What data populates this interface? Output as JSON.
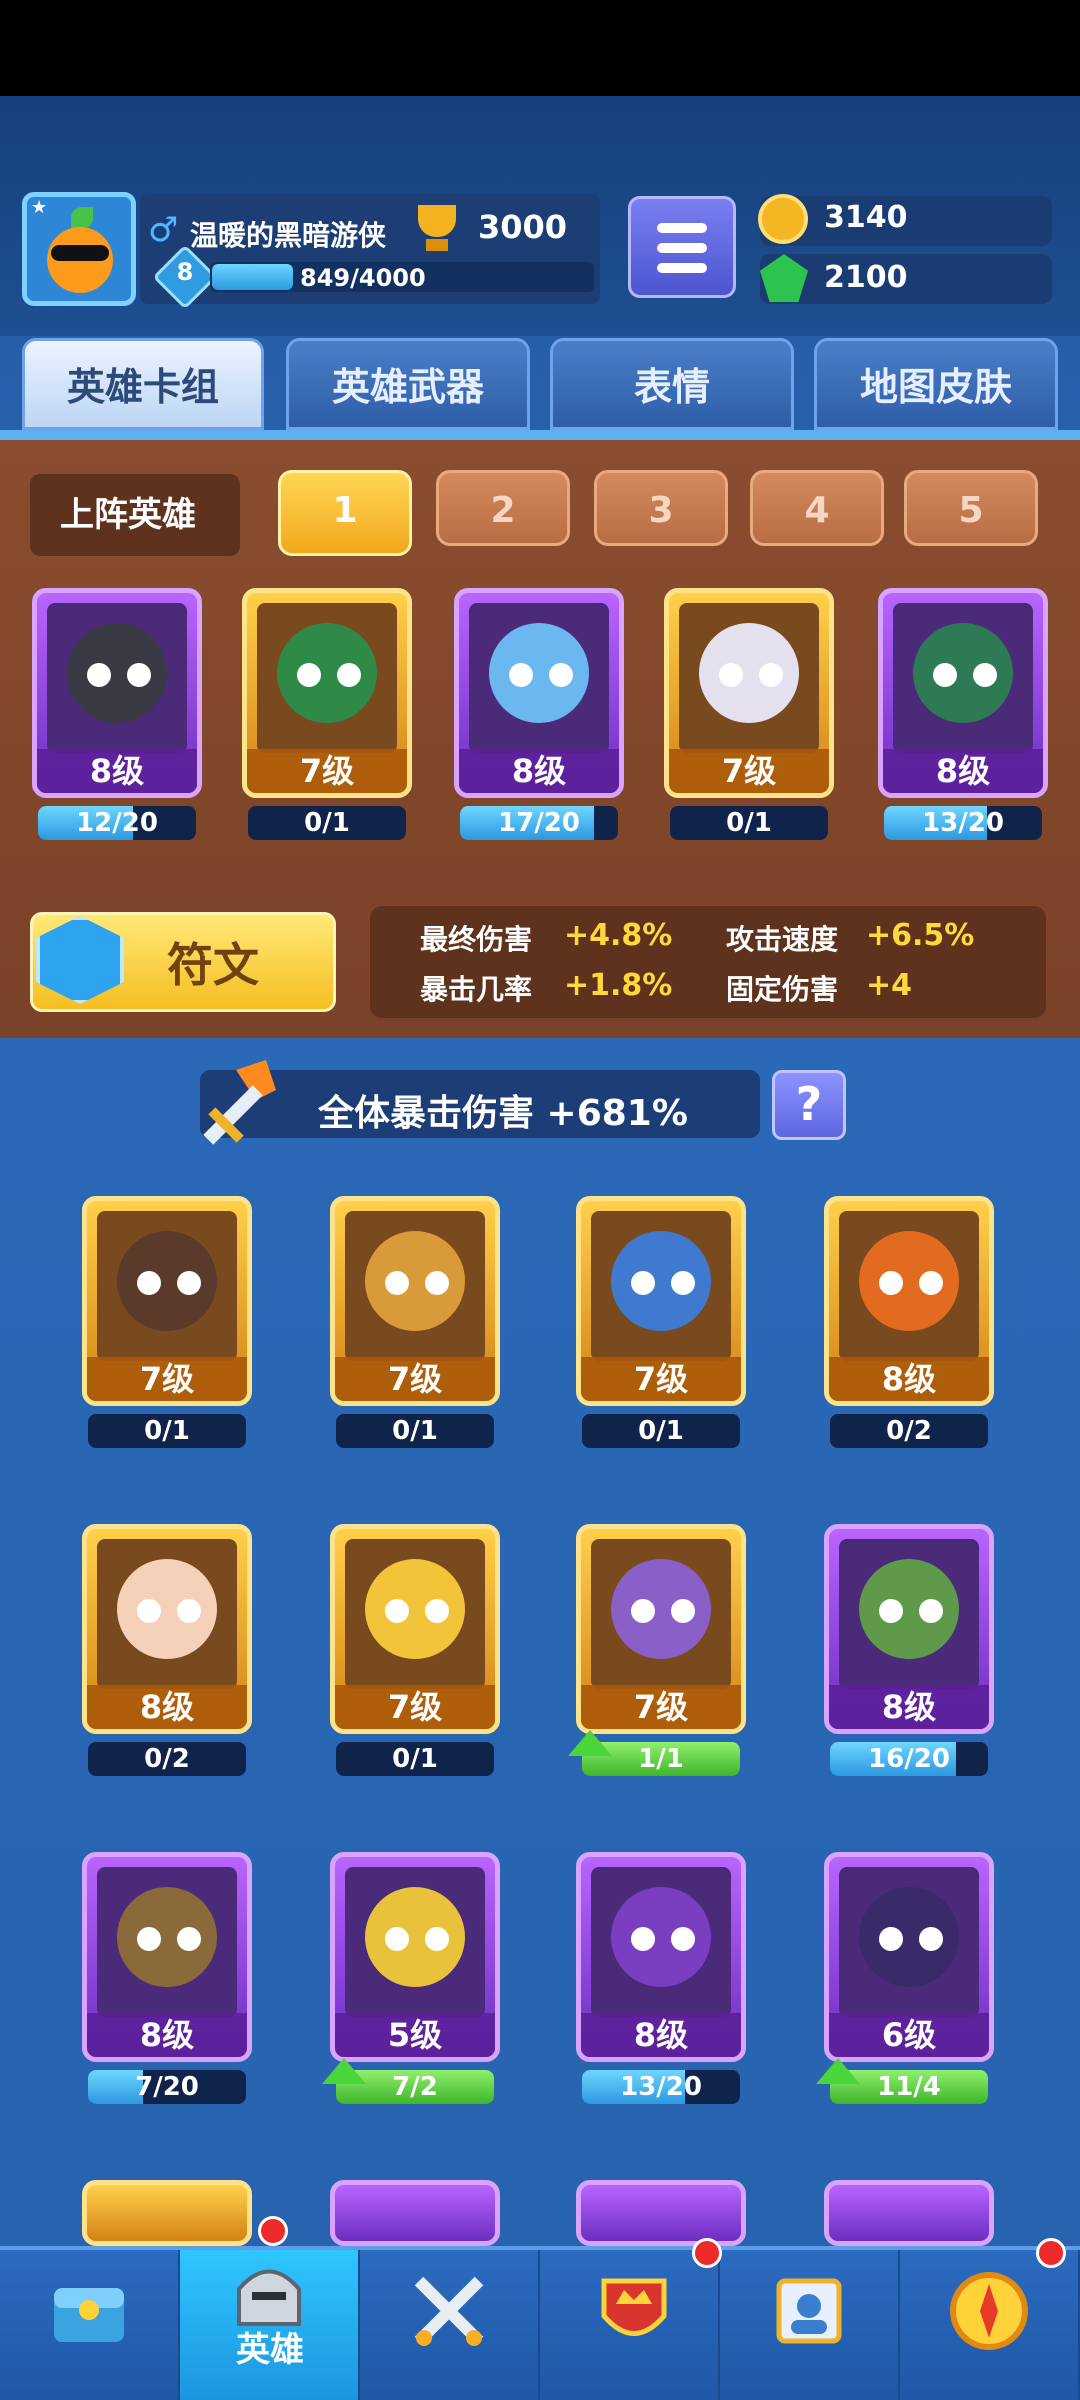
{
  "player": {
    "name": "温暖的黑暗游侠",
    "trophies": "3000",
    "level": "8",
    "xp": "849/4000",
    "xp_fraction": 0.212
  },
  "currency": {
    "coins": "3140",
    "gems": "2100"
  },
  "tabs": [
    "英雄卡组",
    "英雄武器",
    "表情",
    "地图皮肤"
  ],
  "team": {
    "label": "上阵英雄",
    "slots": [
      "1",
      "2",
      "3",
      "4",
      "5"
    ],
    "active_slot": 0
  },
  "lineup": [
    {
      "level": "8级",
      "progress": "12/20",
      "frac": 0.6,
      "rarity": "purple"
    },
    {
      "level": "7级",
      "progress": "0/1",
      "frac": 0,
      "rarity": "gold"
    },
    {
      "level": "8级",
      "progress": "17/20",
      "frac": 0.85,
      "rarity": "purple"
    },
    {
      "level": "7级",
      "progress": "0/1",
      "frac": 0,
      "rarity": "gold"
    },
    {
      "level": "8级",
      "progress": "13/20",
      "frac": 0.65,
      "rarity": "purple"
    }
  ],
  "rune": {
    "label": "符文"
  },
  "stats": [
    {
      "name": "最终伤害",
      "value": "+4.8%"
    },
    {
      "name": "攻击速度",
      "value": "+6.5%"
    },
    {
      "name": "暴击几率",
      "value": "+1.8%"
    },
    {
      "name": "固定伤害",
      "value": "+4"
    }
  ],
  "crit": {
    "text": "全体暴击伤害 +681%"
  },
  "help_label": "?",
  "heroes": [
    {
      "level": "7级",
      "progress": "0/1",
      "frac": 0,
      "rarity": "gold"
    },
    {
      "level": "7级",
      "progress": "0/1",
      "frac": 0,
      "rarity": "gold"
    },
    {
      "level": "7级",
      "progress": "0/1",
      "frac": 0,
      "rarity": "gold"
    },
    {
      "level": "8级",
      "progress": "0/2",
      "frac": 0,
      "rarity": "gold"
    },
    {
      "level": "8级",
      "progress": "0/2",
      "frac": 0,
      "rarity": "gold"
    },
    {
      "level": "7级",
      "progress": "0/1",
      "frac": 0,
      "rarity": "gold"
    },
    {
      "level": "7级",
      "progress": "1/1",
      "frac": 1,
      "rarity": "gold",
      "upgrade": true
    },
    {
      "level": "8级",
      "progress": "16/20",
      "frac": 0.8,
      "rarity": "purple"
    },
    {
      "level": "8级",
      "progress": "7/20",
      "frac": 0.35,
      "rarity": "purple"
    },
    {
      "level": "5级",
      "progress": "7/2",
      "frac": 1,
      "rarity": "purple",
      "upgrade": true
    },
    {
      "level": "8级",
      "progress": "13/20",
      "frac": 0.65,
      "rarity": "purple"
    },
    {
      "level": "6级",
      "progress": "11/4",
      "frac": 1,
      "rarity": "purple",
      "upgrade": true
    }
  ],
  "nav": [
    {
      "icon": "treasure-chest-icon",
      "label": ""
    },
    {
      "icon": "knight-helmet-icon",
      "label": "英雄",
      "active": true
    },
    {
      "icon": "crossed-swords-icon",
      "label": ""
    },
    {
      "icon": "crown-shield-icon",
      "label": ""
    },
    {
      "icon": "team-flag-icon",
      "label": ""
    },
    {
      "icon": "compass-icon",
      "label": ""
    }
  ]
}
